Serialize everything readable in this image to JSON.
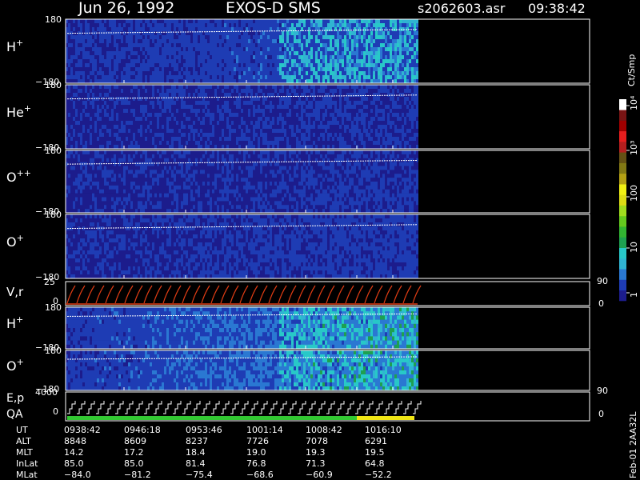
{
  "header": {
    "date": "Jun 26, 1992",
    "instrument": "EXOS-D SMS",
    "file": "s2062603.asr",
    "time": "09:38:42"
  },
  "colorbar": {
    "unit": "Ct/Smp",
    "tick_labels": [
      "1",
      "10",
      "100",
      "10³",
      "10⁴"
    ],
    "tick_values": [
      1,
      10,
      100,
      1000,
      10000
    ],
    "scale": "log",
    "colors": [
      "#1c1c8c",
      "#1e3cb4",
      "#2a78d2",
      "#30b4d2",
      "#28c8c8",
      "#1ea050",
      "#32b432",
      "#64c81e",
      "#a0dc1e",
      "#dcdc14",
      "#f0f014",
      "#b4a014",
      "#827814",
      "#645014",
      "#b41e1e",
      "#e61e1e",
      "#a00000",
      "#781414",
      "#ffffff"
    ]
  },
  "panels": [
    {
      "label": "H",
      "sup": "+",
      "ymax": "180",
      "ymin": "−180"
    },
    {
      "label": "He",
      "sup": "+",
      "ymax": "180",
      "ymin": "−180"
    },
    {
      "label": "O",
      "sup": "++",
      "ymax": "180",
      "ymin": "−180"
    },
    {
      "label": "O",
      "sup": "+",
      "ymax": "180",
      "ymin": "−180"
    }
  ],
  "vr_panel": {
    "label": "V,r",
    "ymax": "25",
    "ymin": "0",
    "right_top": "90",
    "right_bottom": "0"
  },
  "lower_panels": [
    {
      "label": "H",
      "sup": "+",
      "ymax": "180",
      "ymin": "−180"
    },
    {
      "label": "O",
      "sup": "+",
      "ymax": "180",
      "ymin": "−180",
      "right_bottom": "90"
    }
  ],
  "ep_panel": {
    "label": "E,p",
    "label2": "QA",
    "ymax": "4000",
    "ymin": "0",
    "right_bottom": "0"
  },
  "footer_label": "Feb-01 2AA32L",
  "ephemeris": {
    "row_labels": [
      "UT",
      "ALT",
      "MLT",
      "InLat",
      "MLat"
    ],
    "columns": [
      [
        "0938:42",
        "8848",
        "14.2",
        "85.0",
        "−84.0"
      ],
      [
        "0946:18",
        "8609",
        "17.2",
        "85.0",
        "−81.2"
      ],
      [
        "0953:46",
        "8237",
        "18.4",
        "81.4",
        "−75.4"
      ],
      [
        "1001:14",
        "7726",
        "19.0",
        "76.8",
        "−68.6"
      ],
      [
        "1008:42",
        "7078",
        "19.3",
        "71.3",
        "−60.9"
      ],
      [
        "1016:10",
        "6291",
        "19.5",
        "64.8",
        "−52.2"
      ]
    ]
  },
  "chart_data": {
    "type": "heatmap",
    "title": "Jun 26, 1992   EXOS-D SMS",
    "x_ticks_ut": [
      "0938:42",
      "0946:18",
      "0953:46",
      "1001:14",
      "1008:42",
      "1016:10"
    ],
    "y_range_deg": [
      -180,
      180
    ],
    "color_scale": "log",
    "color_range": [
      1,
      10000
    ],
    "qa_bar_colors": [
      "#32c832",
      "#f0e614"
    ]
  }
}
